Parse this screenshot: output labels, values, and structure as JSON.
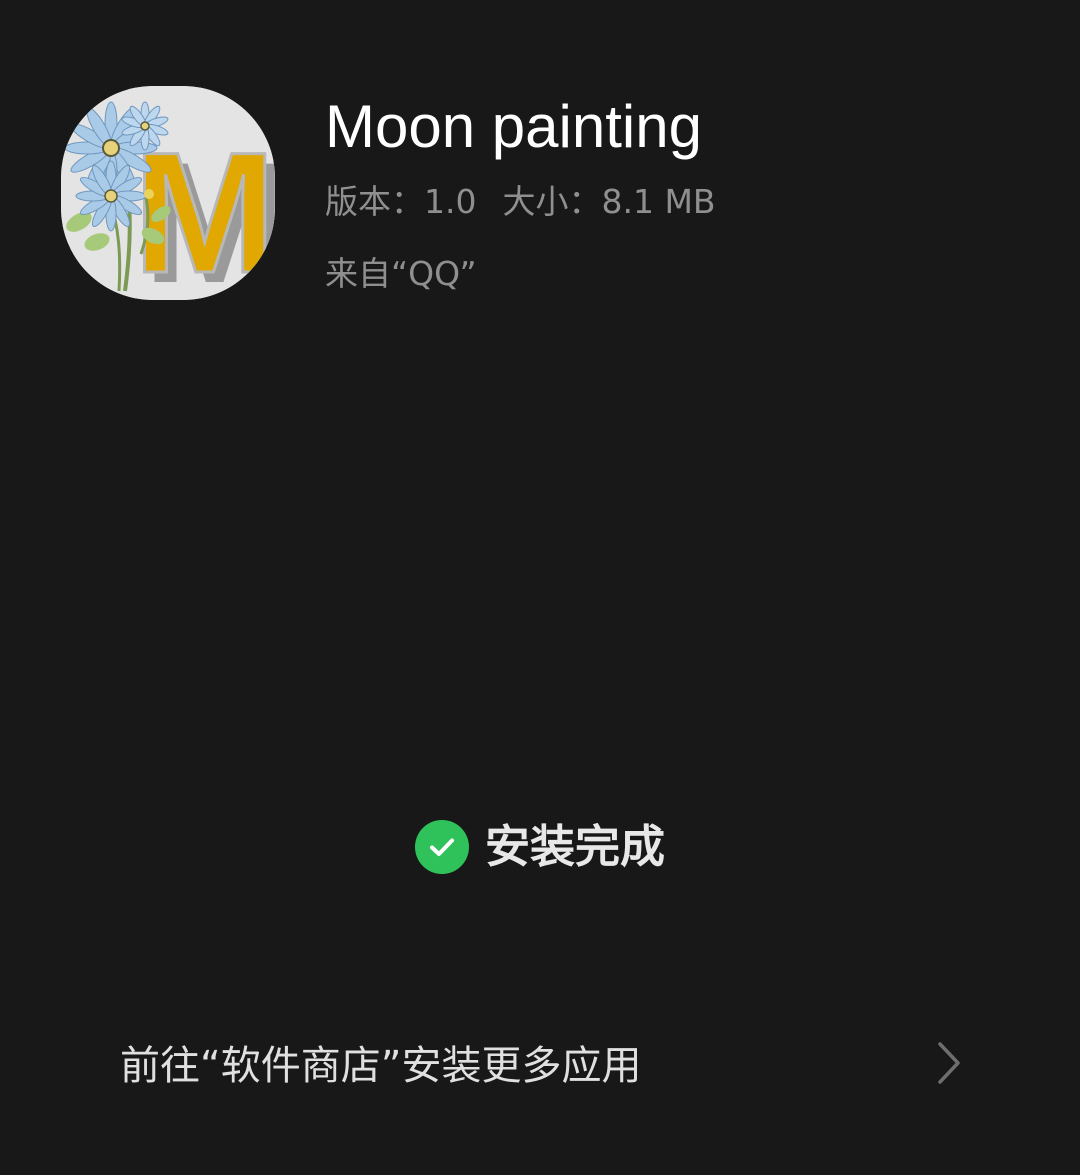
{
  "app": {
    "name": "Moon painting",
    "version_label": "版本：",
    "version": "1.0",
    "size_label": "大小：",
    "size": "8.1 MB",
    "source": "来自“QQ”",
    "icon": "app-icon-letter-m-with-daisies",
    "icon_letter": "M"
  },
  "status": {
    "text": "安装完成",
    "icon": "check-circle-icon",
    "color": "#2fc25b"
  },
  "store_link": {
    "label": "前往“软件商店”安装更多应用",
    "icon": "chevron-right-icon"
  },
  "colors": {
    "background": "#181818",
    "secondary_text": "#8f8f8f",
    "accent_success": "#2fc25b",
    "icon_letter_fill": "#e0a800",
    "icon_flower": "#a9cbe8"
  }
}
